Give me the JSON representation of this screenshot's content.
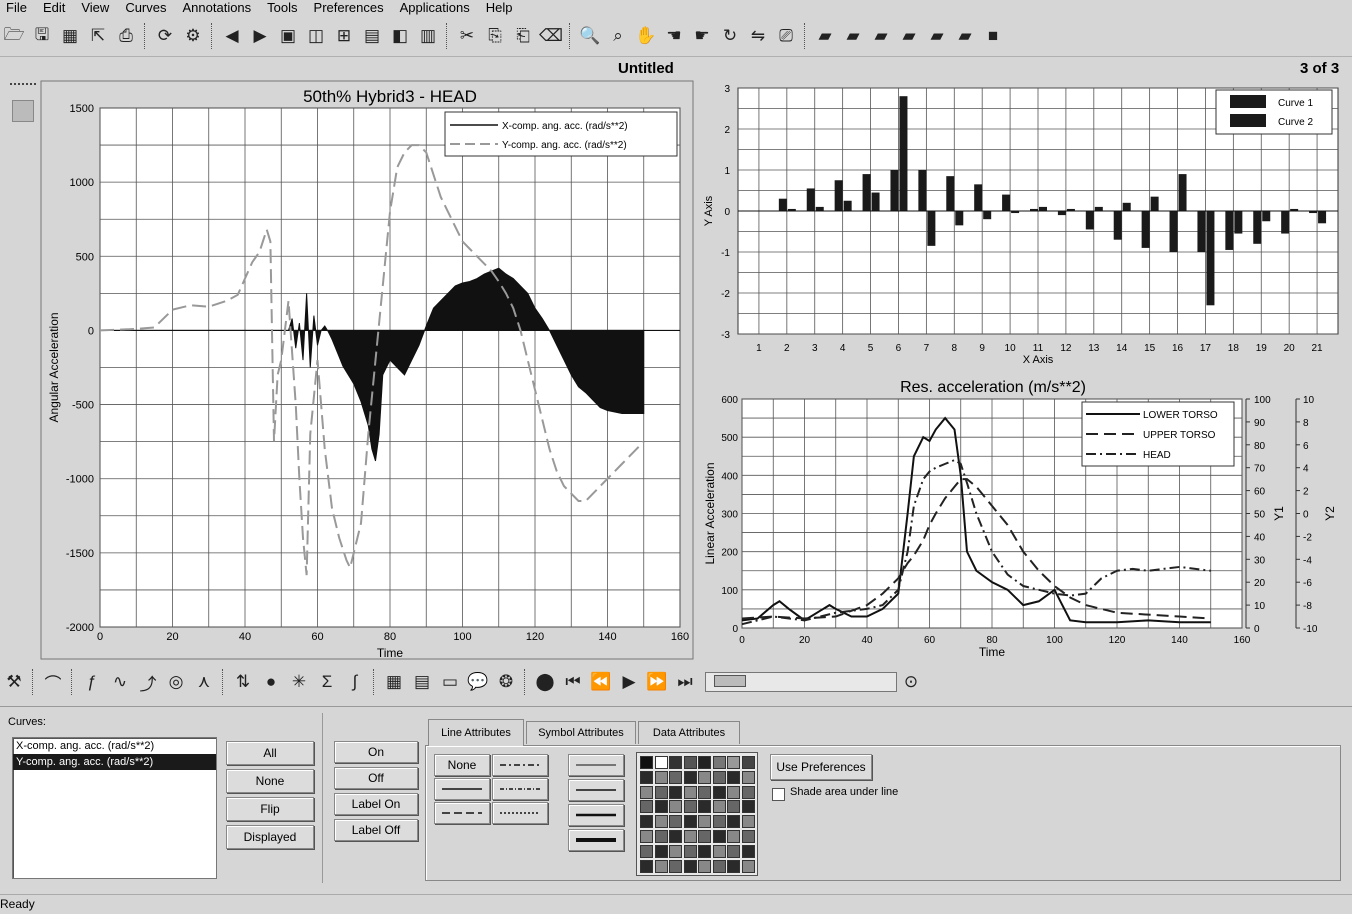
{
  "menu": [
    "File",
    "Edit",
    "View",
    "Curves",
    "Annotations",
    "Tools",
    "Preferences",
    "Applications",
    "Help"
  ],
  "window": {
    "title": "Untitled",
    "page_indicator": "3 of 3"
  },
  "chart_data": [
    {
      "type": "area",
      "title": "50th% Hybrid3   - HEAD",
      "xlabel": "Time",
      "ylabel": "Angular Acceleration",
      "xlim": [
        0,
        160
      ],
      "ylim": [
        -2000,
        1500
      ],
      "xticks": [
        "0",
        "20",
        "40",
        "60",
        "80",
        "100",
        "120",
        "140",
        "160"
      ],
      "yticks": [
        "1500",
        "1000",
        "500",
        "0",
        "-500",
        "-1000",
        "-1500",
        "-2000"
      ],
      "legend_position": "top-right",
      "series": [
        {
          "name": "X-comp. ang. acc. (rad/s**2)",
          "style": "solid-filled",
          "x": [
            0,
            20,
            40,
            44,
            46,
            47,
            48,
            49,
            50,
            51,
            52,
            53,
            54,
            55,
            56,
            57,
            58,
            59,
            60,
            61,
            62,
            63,
            64,
            65,
            66,
            67,
            68,
            69,
            70,
            72,
            74,
            75,
            76,
            77,
            78,
            80,
            82,
            84,
            86,
            88,
            90,
            92,
            94,
            96,
            98,
            100,
            102,
            104,
            106,
            108,
            110,
            112,
            114,
            116,
            118,
            120,
            122,
            124,
            126,
            128,
            130,
            132,
            134,
            136,
            138,
            140,
            142,
            144,
            146,
            148,
            150
          ],
          "y": [
            0,
            0,
            0,
            0,
            0,
            0,
            0,
            0,
            0,
            0,
            0,
            80,
            -120,
            50,
            -200,
            250,
            -250,
            100,
            -100,
            0,
            30,
            -10,
            -60,
            -120,
            -180,
            -240,
            -280,
            -320,
            -360,
            -480,
            -640,
            -800,
            -880,
            -700,
            -300,
            -200,
            -250,
            -300,
            -200,
            -100,
            30,
            150,
            200,
            250,
            300,
            320,
            330,
            350,
            380,
            400,
            420,
            380,
            350,
            300,
            250,
            150,
            80,
            0,
            -100,
            -200,
            -300,
            -380,
            -420,
            -470,
            -520,
            -540,
            -550,
            -560,
            -560,
            -560,
            -560
          ]
        },
        {
          "name": "Y-comp. ang. acc. (rad/s**2)",
          "style": "dashed",
          "x": [
            0,
            10,
            15,
            20,
            25,
            30,
            35,
            38,
            40,
            42,
            44,
            46,
            47,
            48,
            49,
            50,
            52,
            54,
            55,
            56,
            57,
            58,
            60,
            62,
            64,
            66,
            68,
            69,
            70,
            72,
            74,
            76,
            78,
            80,
            82,
            84,
            86,
            88,
            90,
            92,
            94,
            96,
            98,
            100,
            102,
            104,
            106,
            108,
            110,
            112,
            114,
            116,
            118,
            120,
            122,
            124,
            126,
            128,
            130,
            132,
            134,
            136,
            138,
            140,
            142,
            144,
            146,
            148,
            150
          ],
          "y": [
            0,
            10,
            20,
            140,
            170,
            160,
            200,
            240,
            350,
            460,
            530,
            680,
            600,
            -750,
            -300,
            -200,
            200,
            -500,
            -1000,
            -1400,
            -1650,
            -700,
            -200,
            -800,
            -1200,
            -1400,
            -1550,
            -1600,
            -1500,
            -1300,
            -700,
            -200,
            300,
            800,
            1100,
            1200,
            1250,
            1250,
            1200,
            1050,
            900,
            800,
            700,
            600,
            550,
            500,
            450,
            400,
            330,
            250,
            150,
            0,
            -200,
            -400,
            -600,
            -800,
            -950,
            -1050,
            -1100,
            -1150,
            -1150,
            -1100,
            -1050,
            -1000,
            -950,
            -900,
            -850,
            -800,
            -750
          ]
        }
      ]
    },
    {
      "type": "bar",
      "title": "",
      "xlabel": "X Axis",
      "ylabel": "Y Axis",
      "ylim": [
        -3,
        3
      ],
      "yticks": [
        "3",
        "2",
        "1",
        "0",
        "-1",
        "-2",
        "-3"
      ],
      "categories": [
        "1",
        "2",
        "3",
        "4",
        "5",
        "6",
        "7",
        "8",
        "9",
        "10",
        "11",
        "12",
        "13",
        "14",
        "15",
        "16",
        "17",
        "18",
        "19",
        "20",
        "21"
      ],
      "legend_position": "top-right",
      "series": [
        {
          "name": "Curve 1",
          "values": [
            0,
            0.3,
            0.55,
            0.75,
            0.9,
            1.0,
            1.0,
            0.85,
            0.65,
            0.4,
            0.05,
            -0.1,
            -0.45,
            -0.7,
            -0.9,
            -1.0,
            -1.0,
            -0.95,
            -0.8,
            -0.55,
            -0.05
          ]
        },
        {
          "name": "Curve 2",
          "values": [
            0,
            0.05,
            0.1,
            0.25,
            0.45,
            2.8,
            -0.85,
            -0.35,
            -0.2,
            -0.05,
            0.1,
            0.05,
            0.1,
            0.2,
            0.35,
            0.9,
            -2.3,
            -0.55,
            -0.25,
            0.05,
            -0.3
          ]
        }
      ]
    },
    {
      "type": "line",
      "title": "Res. acceleration (m/s**2)",
      "xlabel": "Time",
      "ylabel": "Linear Acceleration",
      "y1label": "Y1",
      "y2label": "Y2",
      "xlim": [
        0,
        160
      ],
      "ylim": [
        0,
        600
      ],
      "xticks": [
        "0",
        "20",
        "40",
        "60",
        "80",
        "100",
        "120",
        "140",
        "160"
      ],
      "yticks": [
        "600",
        "500",
        "400",
        "300",
        "200",
        "100",
        "0"
      ],
      "y1ticks": [
        "100",
        "90",
        "80",
        "70",
        "60",
        "50",
        "40",
        "30",
        "20",
        "10",
        "0"
      ],
      "y2ticks": [
        "10",
        "8",
        "6",
        "4",
        "2",
        "0",
        "-2",
        "-4",
        "-6",
        "-8",
        "-10"
      ],
      "legend_position": "top-right",
      "series": [
        {
          "name": "LOWER TORSO",
          "style": "solid",
          "x": [
            0,
            5,
            10,
            12,
            15,
            20,
            25,
            28,
            30,
            35,
            40,
            45,
            50,
            53,
            55,
            58,
            60,
            62,
            65,
            68,
            70,
            72,
            75,
            80,
            85,
            90,
            95,
            100,
            105,
            110,
            120,
            130,
            140,
            150
          ],
          "y": [
            20,
            25,
            60,
            70,
            50,
            20,
            45,
            60,
            50,
            30,
            30,
            50,
            90,
            300,
            450,
            500,
            490,
            520,
            550,
            520,
            400,
            200,
            150,
            120,
            100,
            60,
            70,
            100,
            20,
            15,
            15,
            20,
            15,
            15
          ]
        },
        {
          "name": "UPPER TORSO",
          "style": "dashed",
          "x": [
            0,
            10,
            20,
            30,
            40,
            45,
            50,
            53,
            55,
            58,
            60,
            62,
            65,
            68,
            70,
            72,
            75,
            80,
            85,
            90,
            95,
            100,
            105,
            110,
            120,
            130,
            140,
            150
          ],
          "y": [
            25,
            30,
            25,
            30,
            60,
            90,
            130,
            170,
            190,
            230,
            270,
            300,
            340,
            370,
            390,
            390,
            370,
            320,
            270,
            200,
            150,
            110,
            80,
            60,
            40,
            35,
            30,
            25
          ]
        },
        {
          "name": "HEAD",
          "style": "dash-dot",
          "x": [
            0,
            10,
            20,
            30,
            40,
            45,
            50,
            53,
            55,
            58,
            60,
            62,
            65,
            68,
            70,
            72,
            75,
            80,
            85,
            90,
            95,
            100,
            105,
            110,
            115,
            120,
            125,
            130,
            140,
            150
          ],
          "y": [
            10,
            30,
            20,
            40,
            50,
            60,
            100,
            200,
            320,
            390,
            410,
            420,
            430,
            440,
            430,
            380,
            300,
            200,
            140,
            110,
            100,
            90,
            85,
            90,
            130,
            150,
            155,
            150,
            160,
            150
          ]
        }
      ]
    }
  ],
  "toolbar2": {
    "slider_value": 0.05
  },
  "bottom": {
    "curves_label": "Curves:",
    "curves_list": [
      "X-comp. ang. acc. (rad/s**2)",
      "Y-comp. ang. acc. (rad/s**2)"
    ],
    "selected_index": 1,
    "select_buttons": [
      "All",
      "None",
      "Flip",
      "Displayed"
    ],
    "on_off_buttons": [
      "On",
      "Off",
      "Label On",
      "Label Off"
    ],
    "tabs": [
      "Line Attributes",
      "Symbol Attributes",
      "Data Attributes"
    ],
    "active_tab": "Line Attributes",
    "line_style_none": "None",
    "use_preferences": "Use Preferences",
    "shade_label": "Shade area under line",
    "shade_checked": false
  },
  "status": "Ready"
}
